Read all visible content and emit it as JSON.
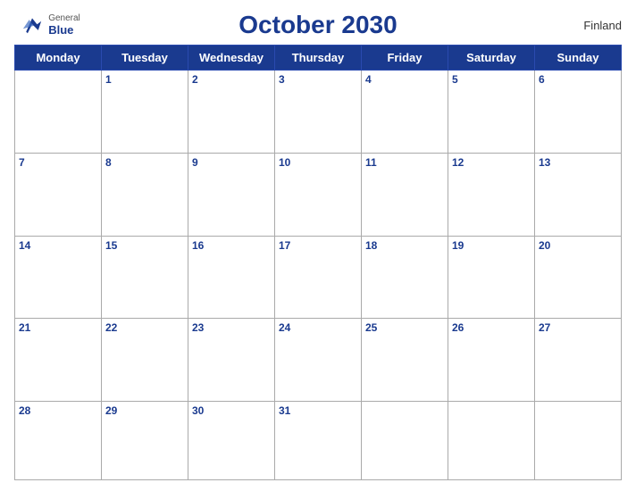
{
  "header": {
    "logo": {
      "general": "General",
      "blue": "Blue",
      "bird_alt": "GeneralBlue logo"
    },
    "title": "October 2030",
    "country": "Finland"
  },
  "days_of_week": [
    "Monday",
    "Tuesday",
    "Wednesday",
    "Thursday",
    "Friday",
    "Saturday",
    "Sunday"
  ],
  "weeks": [
    [
      "",
      "1",
      "2",
      "3",
      "4",
      "5",
      "6"
    ],
    [
      "7",
      "8",
      "9",
      "10",
      "11",
      "12",
      "13"
    ],
    [
      "14",
      "15",
      "16",
      "17",
      "18",
      "19",
      "20"
    ],
    [
      "21",
      "22",
      "23",
      "24",
      "25",
      "26",
      "27"
    ],
    [
      "28",
      "29",
      "30",
      "31",
      "",
      "",
      ""
    ]
  ]
}
